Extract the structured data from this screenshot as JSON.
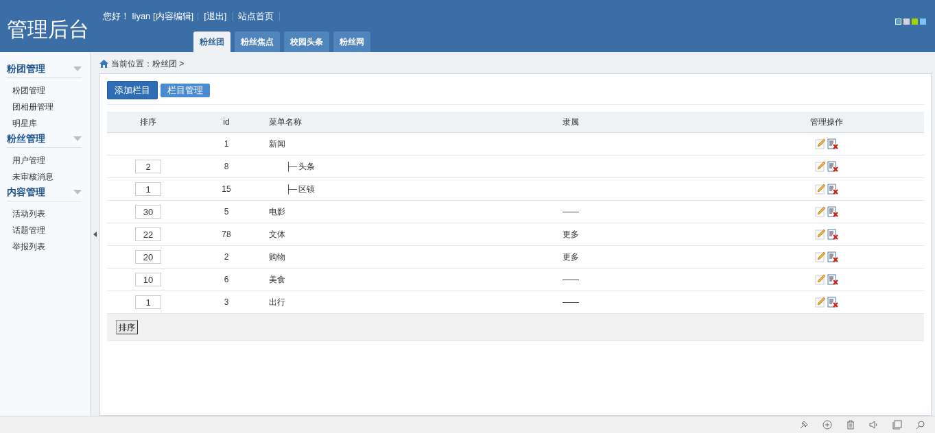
{
  "header": {
    "logo": "管理后台",
    "greeting": "您好！ liyan [内容编辑]",
    "links": [
      "[退出]",
      "站点首页"
    ],
    "tabs": [
      {
        "label": "粉丝团",
        "selected": true
      },
      {
        "label": "粉丝焦点",
        "selected": false
      },
      {
        "label": "校园头条",
        "selected": false
      },
      {
        "label": "粉丝网",
        "selected": false
      }
    ]
  },
  "sidebar": [
    {
      "title": "粉团管理",
      "expanded": true,
      "items": [
        "粉团管理",
        "团相册管理",
        "明星库"
      ]
    },
    {
      "title": "粉丝管理",
      "expanded": true,
      "items": [
        "用户管理",
        "未审核消息"
      ]
    },
    {
      "title": "内容管理",
      "expanded": true,
      "items": [
        "活动列表",
        "话题管理",
        "举报列表"
      ]
    }
  ],
  "breadcrumb": "当前位置：粉丝团 >",
  "actions": [
    {
      "label": "添加栏目",
      "selected": true
    },
    {
      "label": "栏目管理",
      "selected": false
    }
  ],
  "table": {
    "columns": [
      "排序",
      "id",
      "菜单名称",
      "隶属",
      "管理操作"
    ],
    "rows": [
      {
        "id": "1",
        "name": "新闻",
        "children": [
          {
            "order": "2",
            "id": "8",
            "branch": "├─",
            "name": "头条"
          },
          {
            "order": "1",
            "id": "15",
            "branch": "├─",
            "name": "区镇"
          }
        ]
      },
      {
        "order": "30",
        "id": "5",
        "name": "电影",
        "parent": "——"
      },
      {
        "order": "22",
        "id": "78",
        "name": "文体",
        "parent": "更多"
      },
      {
        "order": "20",
        "id": "2",
        "name": "购物",
        "parent": "更多"
      },
      {
        "order": "10",
        "id": "6",
        "name": "美食",
        "parent": "——"
      },
      {
        "order": "1",
        "id": "3",
        "name": "出行",
        "parent": "——"
      }
    ]
  },
  "sort_button": "排序"
}
